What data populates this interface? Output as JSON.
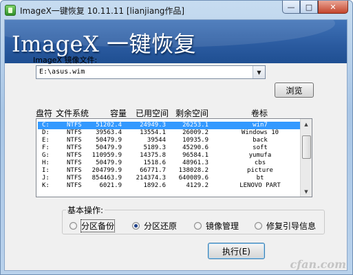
{
  "window": {
    "title": "ImageX一键恢复 10.11.11 [lianjiang作品]",
    "controls": {
      "minimize": "—",
      "maximize": "□",
      "close": "✕"
    },
    "icon": "app-icon"
  },
  "banner": {
    "text": "ImageX 一键恢复"
  },
  "image_file": {
    "label": "ImageX 镜像文件:",
    "value": "E:\\asus.wim",
    "browse_label": "浏览"
  },
  "partition_table": {
    "headers": {
      "drive": "盘符",
      "fs": "文件系统",
      "capacity": "容量",
      "used": "已用空间",
      "free": "剩余空间",
      "volume": "卷标"
    },
    "rows": [
      {
        "drive": "C:",
        "fs": "NTFS",
        "capacity": "51202.4",
        "used": "24949.3",
        "free": "26253.1",
        "volume": "win7",
        "selected": true
      },
      {
        "drive": "D:",
        "fs": "NTFS",
        "capacity": "39563.4",
        "used": "13554.1",
        "free": "26009.2",
        "volume": "Windows 10"
      },
      {
        "drive": "E:",
        "fs": "NTFS",
        "capacity": "50479.9",
        "used": "39544",
        "free": "10935.9",
        "volume": "back"
      },
      {
        "drive": "F:",
        "fs": "NTFS",
        "capacity": "50479.9",
        "used": "5189.3",
        "free": "45290.6",
        "volume": "soft"
      },
      {
        "drive": "G:",
        "fs": "NTFS",
        "capacity": "110959.9",
        "used": "14375.8",
        "free": "96584.1",
        "volume": "yumufa"
      },
      {
        "drive": "H:",
        "fs": "NTFS",
        "capacity": "50479.9",
        "used": "1518.6",
        "free": "48961.3",
        "volume": "cbs"
      },
      {
        "drive": "I:",
        "fs": "NTFS",
        "capacity": "204799.9",
        "used": "66771.7",
        "free": "138028.2",
        "volume": "picture"
      },
      {
        "drive": "J:",
        "fs": "NTFS",
        "capacity": "854463.9",
        "used": "214374.3",
        "free": "640089.6",
        "volume": "bt"
      },
      {
        "drive": "K:",
        "fs": "NTFS",
        "capacity": "6021.9",
        "used": "1892.6",
        "free": "4129.2",
        "volume": "LENOVO PART"
      }
    ]
  },
  "operations": {
    "title": "基本操作:",
    "options": [
      {
        "label": "分区备份",
        "checked": false
      },
      {
        "label": "分区还原",
        "checked": true
      },
      {
        "label": "镜像管理",
        "checked": false
      },
      {
        "label": "修复引导信息",
        "checked": false
      }
    ]
  },
  "execute_label": "执行(E)",
  "watermark": "cfan.com"
}
